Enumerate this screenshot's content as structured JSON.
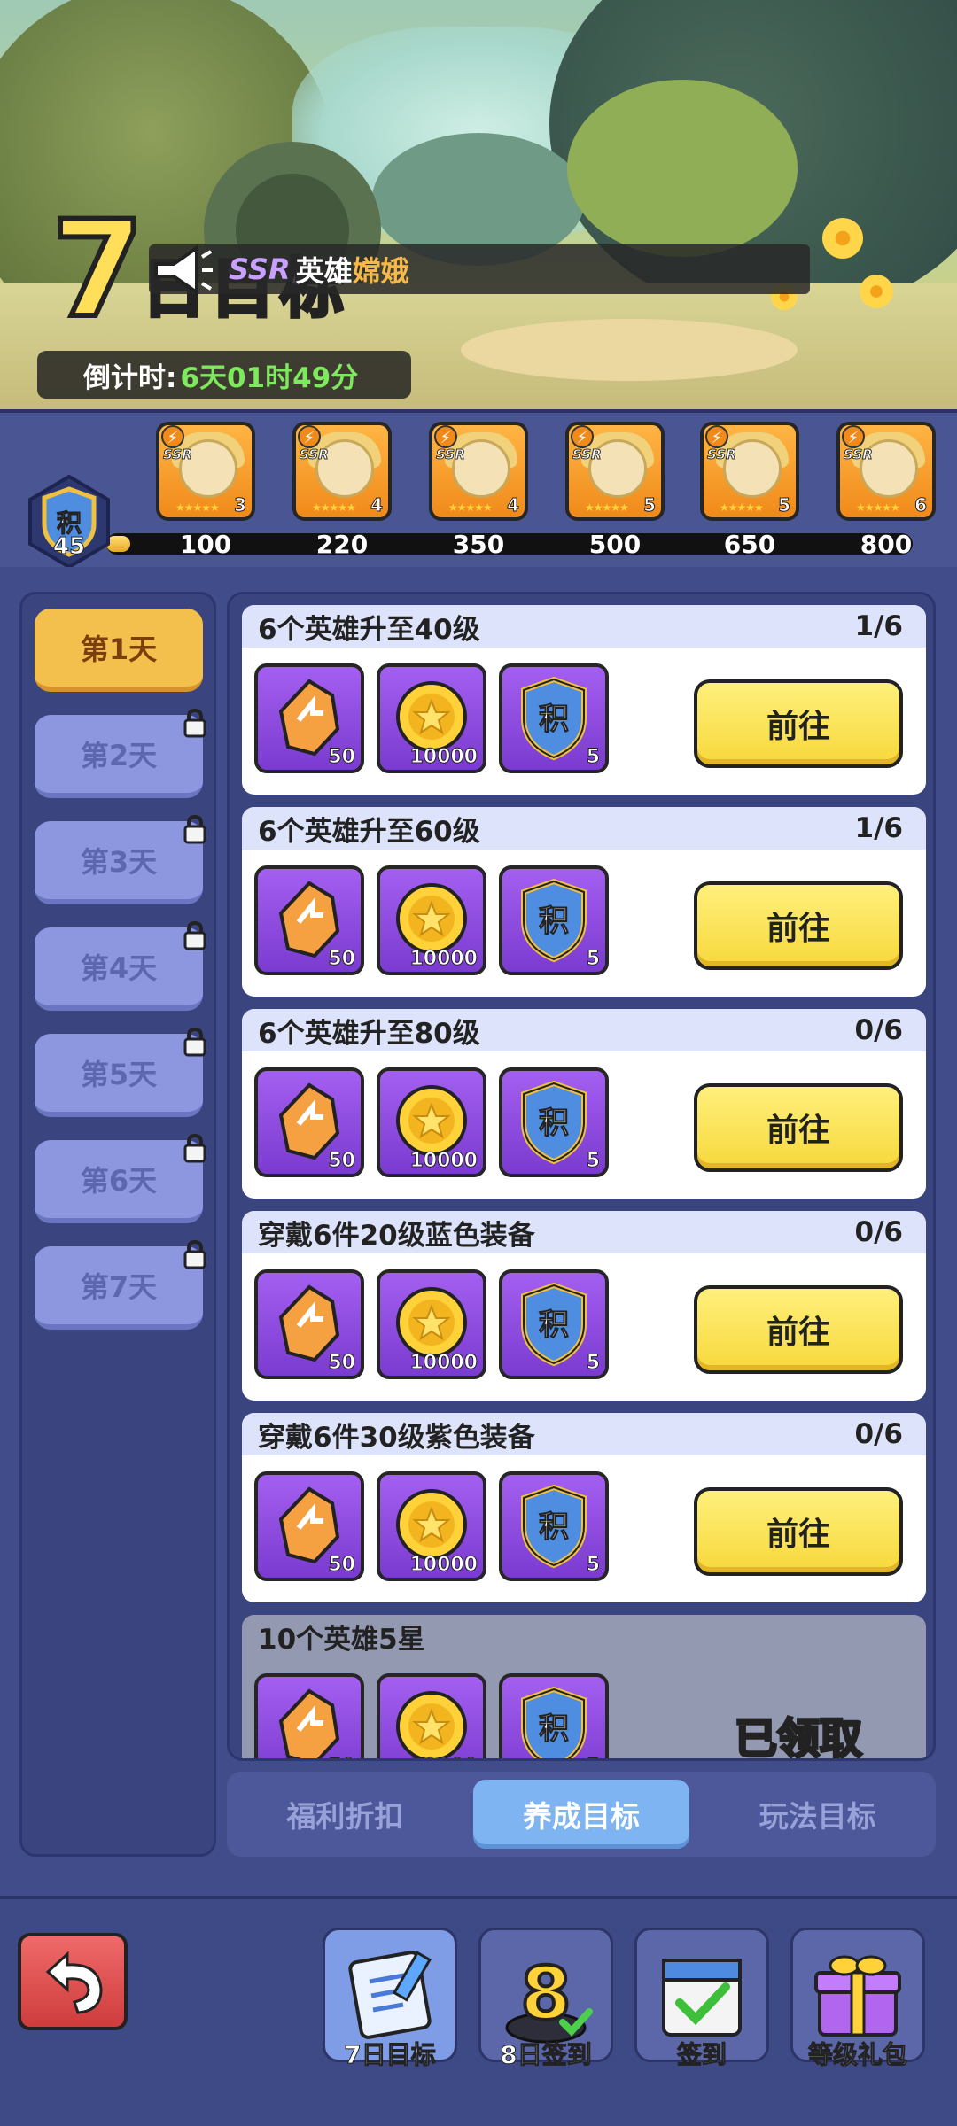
{
  "banner": {
    "big_number": "7",
    "title_partial": "日目标",
    "notice": {
      "ssr_tag": "SSR",
      "text": "英雄",
      "hero_name": "嫦娥"
    },
    "countdown": {
      "label": "倒计时:",
      "value": "6天01时49分"
    }
  },
  "points": {
    "shield_char": "积",
    "value": "45",
    "progress": 0.03,
    "milestones": [
      {
        "label": "100",
        "stars": "3"
      },
      {
        "label": "220",
        "stars": "4"
      },
      {
        "label": "350",
        "stars": "4"
      },
      {
        "label": "500",
        "stars": "5"
      },
      {
        "label": "650",
        "stars": "5"
      },
      {
        "label": "800",
        "stars": "6"
      }
    ],
    "ssr_tag": "SSR"
  },
  "days": [
    {
      "label": "第1天",
      "locked": false
    },
    {
      "label": "第2天",
      "locked": true
    },
    {
      "label": "第3天",
      "locked": true
    },
    {
      "label": "第4天",
      "locked": true
    },
    {
      "label": "第5天",
      "locked": true
    },
    {
      "label": "第6天",
      "locked": true
    },
    {
      "label": "第7天",
      "locked": true
    }
  ],
  "tasks": [
    {
      "title": "6个英雄升至40级",
      "progress": "1/6",
      "button": "前往"
    },
    {
      "title": "6个英雄升至60级",
      "progress": "1/6",
      "button": "前往"
    },
    {
      "title": "6个英雄升至80级",
      "progress": "0/6",
      "button": "前往"
    },
    {
      "title": "穿戴6件20级蓝色装备",
      "progress": "0/6",
      "button": "前往"
    },
    {
      "title": "穿戴6件30级紫色装备",
      "progress": "0/6",
      "button": "前往"
    },
    {
      "title": "10个英雄5星",
      "progress": "",
      "button": "已领取"
    }
  ],
  "rewards": [
    {
      "icon": "gem-icon",
      "qty": "50"
    },
    {
      "icon": "gold-coin-icon",
      "qty": "10000"
    },
    {
      "icon": "points-shield-icon",
      "qty": "5",
      "char": "积"
    }
  ],
  "tabs": [
    "福利折扣",
    "养成目标",
    "玩法目标"
  ],
  "nav": [
    {
      "label": "7日目标",
      "icon": "scroll-icon"
    },
    {
      "label": "8日签到",
      "icon": "number-eight-icon"
    },
    {
      "label": "签到",
      "icon": "calendar-check-icon"
    },
    {
      "label": "等级礼包",
      "icon": "gift-box-icon"
    }
  ],
  "colors": {
    "accent_yellow": "#f7d83c",
    "active_day": "#f4c04d",
    "active_tab": "#7fb4f2",
    "panel": "#3a4580",
    "countdown_green": "#7ee85e"
  }
}
